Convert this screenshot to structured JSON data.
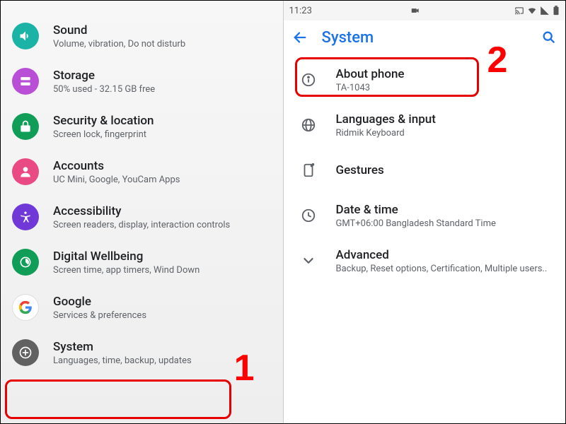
{
  "left": {
    "items": [
      {
        "icon": "sound",
        "color": "#1ab3a6",
        "title": "Sound",
        "sub": "Volume, vibration, Do not disturb"
      },
      {
        "icon": "storage",
        "color": "#b84fd6",
        "title": "Storage",
        "sub": "50% used - 32.15 GB free"
      },
      {
        "icon": "lock",
        "color": "#0f9d58",
        "title": "Security & location",
        "sub": "Screen lock, fingerprint"
      },
      {
        "icon": "accounts",
        "color": "#e94a83",
        "title": "Accounts",
        "sub": "UC Mini, Google, YouCam Apps"
      },
      {
        "icon": "accessibility",
        "color": "#7038d6",
        "title": "Accessibility",
        "sub": "Screen readers, display, interaction controls"
      },
      {
        "icon": "wellbeing",
        "color": "#0f9d58",
        "title": "Digital Wellbeing",
        "sub": "Screen time, app timers, Wind Down"
      },
      {
        "icon": "google",
        "color": "#ffffff",
        "title": "Google",
        "sub": "Services & preferences"
      },
      {
        "icon": "system",
        "color": "#616161",
        "title": "System",
        "sub": "Languages, time, backup, updates"
      }
    ]
  },
  "right": {
    "statusbar": {
      "time": "11:23"
    },
    "header": {
      "title": "System"
    },
    "items": [
      {
        "icon": "info",
        "title": "About phone",
        "sub": "TA-1043"
      },
      {
        "icon": "globe",
        "title": "Languages & input",
        "sub": "Ridmik Keyboard"
      },
      {
        "icon": "gestures",
        "title": "Gestures",
        "sub": ""
      },
      {
        "icon": "clock",
        "title": "Date & time",
        "sub": "GMT+06:00 Bangladesh Standard Time"
      },
      {
        "icon": "expand",
        "title": "Advanced",
        "sub": "Backup, Reset options, Certification, Multiple users.."
      }
    ]
  },
  "annotations": {
    "one": "1",
    "two": "2"
  }
}
